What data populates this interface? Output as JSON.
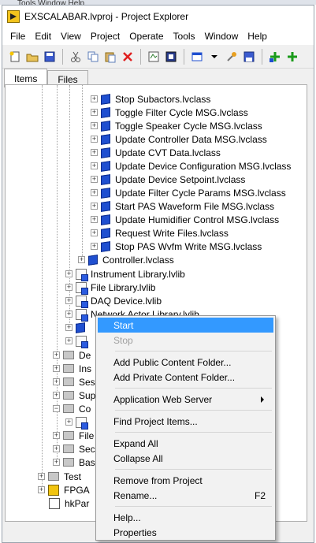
{
  "background_window": {
    "title_fragment": "Tools Window Help"
  },
  "window": {
    "title": "EXSCALABAR.lvproj - Project Explorer"
  },
  "menubar": [
    "File",
    "Edit",
    "View",
    "Project",
    "Operate",
    "Tools",
    "Window",
    "Help"
  ],
  "toolbar_icons": [
    "new-icon",
    "open-icon",
    "save-all-icon",
    "cut-icon",
    "copy-icon",
    "paste-icon",
    "delete-icon",
    "build-icon",
    "deploy-icon",
    "view-icon",
    "chevron-down-icon",
    "wrench-icon",
    "save-icon",
    "expand-icon",
    "add-icon"
  ],
  "tabs": [
    "Items",
    "Files"
  ],
  "tree": {
    "classes": [
      "Stop Subactors.lvclass",
      "Toggle Filter Cycle MSG.lvclass",
      "Toggle Speaker Cycle MSG.lvclass",
      "Update Controller Data MSG.lvclass",
      "Update CVT Data.lvclass",
      "Update Device Configuration MSG.lvclass",
      "Update Device Setpoint.lvclass",
      "Update Filter Cycle Params MSG.lvclass",
      "Start PAS Waveform File MSG.lvclass",
      "Update Humidifier Control MSG.lvclass",
      "Request Write Files.lvclass",
      "Stop PAS Wvfm Write MSG.lvclass"
    ],
    "controller": "Controller.lvclass",
    "libraries": [
      "Instrument Library.lvlib",
      "File Library.lvlib",
      "DAQ Device.lvlib",
      "Network Actor Library.lvlib"
    ],
    "folders": [
      "De",
      "Ins",
      "Ses",
      "Sup",
      "Co",
      "File",
      "Sec",
      "Bas"
    ],
    "bottom": [
      "Test",
      "FPGA",
      "hkPar"
    ]
  },
  "context_menu": {
    "start": "Start",
    "stop": "Stop",
    "add_public": "Add Public Content Folder...",
    "add_private": "Add Private Content Folder...",
    "web_server": "Application Web Server",
    "find": "Find Project Items...",
    "expand_all": "Expand All",
    "collapse_all": "Collapse All",
    "remove": "Remove from Project",
    "rename": "Rename...",
    "rename_shortcut": "F2",
    "help": "Help...",
    "properties": "Properties"
  },
  "colors": {
    "highlight": "#3399ff",
    "cube": "#1f4fd0"
  }
}
